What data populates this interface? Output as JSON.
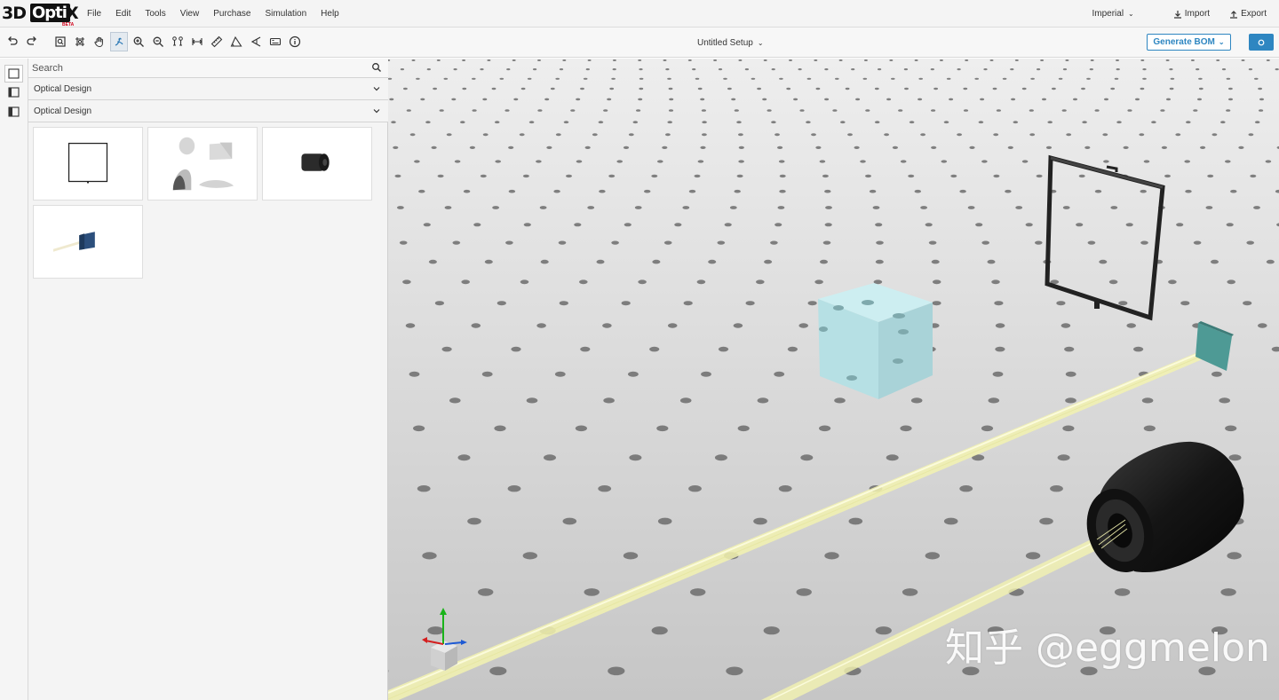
{
  "app": {
    "logo_text": "3D",
    "logo_box_text": "Opti",
    "logo_x_text": "X",
    "logo_badge": "BETA"
  },
  "menu": {
    "items": [
      "File",
      "Edit",
      "Tools",
      "View",
      "Purchase",
      "Simulation",
      "Help"
    ]
  },
  "menubar_right": {
    "units": "Imperial",
    "import_label": "Import",
    "export_label": "Export"
  },
  "toolbar": {
    "setup_title": "Untitled Setup",
    "bom_label": "Generate BOM"
  },
  "sidebar": {
    "search_placeholder": "Search",
    "dropdown_1": "Optical Design",
    "dropdown_2": "Optical Design"
  },
  "viewport": {
    "watermark": "知乎 @eggmelon",
    "table_color": "#cfcfcf",
    "beam_color": "#f6f6b8",
    "cube_color": "#b9e2e6",
    "detector_color": "#4e9a95"
  }
}
